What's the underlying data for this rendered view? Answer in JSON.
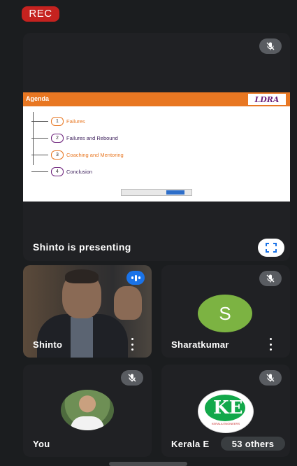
{
  "recording": {
    "label": "REC"
  },
  "presentation": {
    "presenter_label": "Shinto is presenting",
    "slide": {
      "title": "Agenda",
      "logo_text": "LDRA",
      "items": [
        {
          "number": "1",
          "text": "Failures",
          "color": "#e87722"
        },
        {
          "number": "2",
          "text": "Failures and Rebound",
          "color": "#3b1e5a"
        },
        {
          "number": "3",
          "text": "Coaching and Mentoring",
          "color": "#e87722"
        },
        {
          "number": "4",
          "text": "Conclusion",
          "color": "#3b1e5a"
        }
      ]
    }
  },
  "participants": [
    {
      "name": "Shinto",
      "speaking": true
    },
    {
      "name": "Sharatkumar",
      "initial": "S",
      "avatar_color": "#7cb342",
      "muted": true
    },
    {
      "name": "You",
      "muted": true
    },
    {
      "name": "Kerala E",
      "muted": true,
      "others_label": "53 others"
    }
  ],
  "colors": {
    "accent": "#1a73e8",
    "rec": "#c5221f",
    "slide_header": "#e87722"
  }
}
